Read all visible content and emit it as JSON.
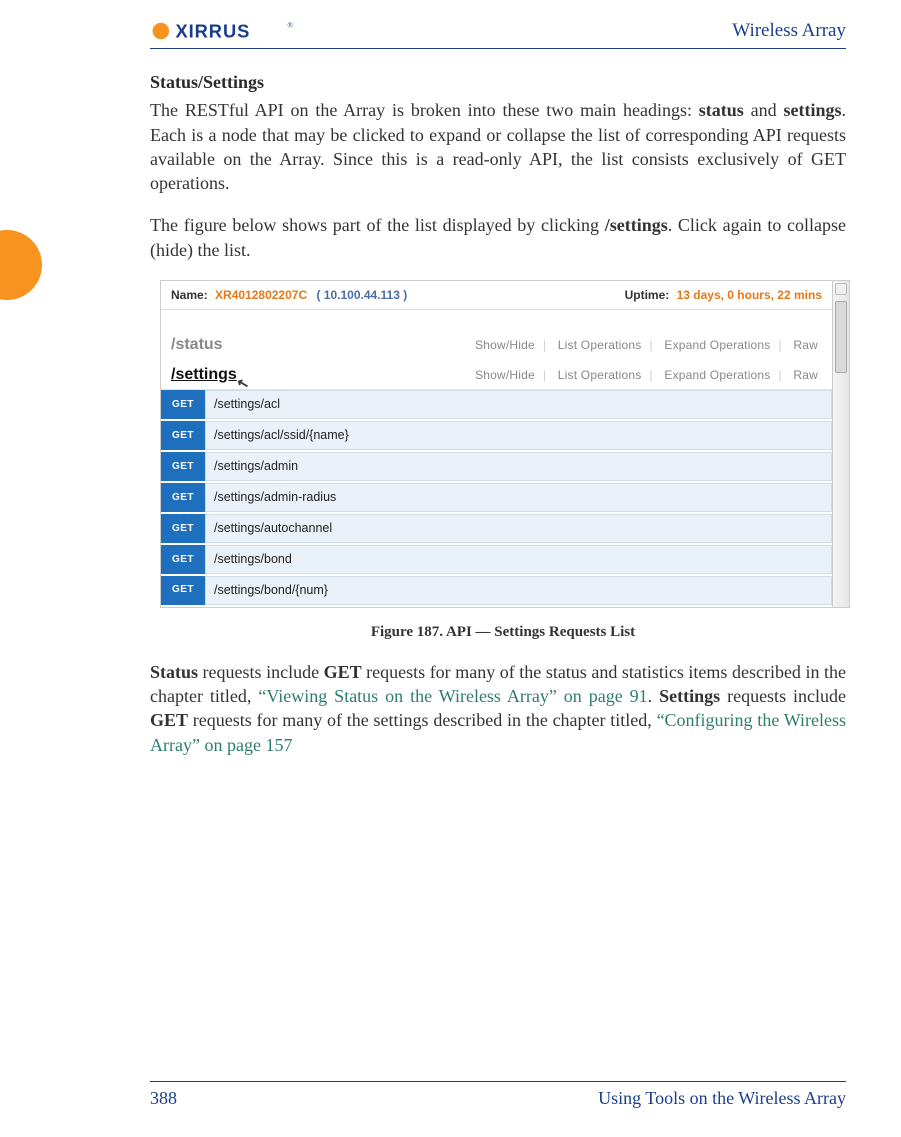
{
  "header": {
    "right_title": "Wireless Array"
  },
  "section": {
    "title": "Status/Settings"
  },
  "para1": {
    "t1": "The RESTful API on the Array is broken into these two main headings: ",
    "b1": "status",
    "t2": " and ",
    "b2": "settings",
    "t3": ". Each is a node that may be clicked to expand or collapse the list of corresponding API requests available on the Array. Since this is a read-only API, the list consists exclusively of GET operations."
  },
  "para2": {
    "t1": "The figure below shows part of the list displayed by clicking ",
    "b1": "/settings",
    "t2": ". Click again to collapse (hide) the list."
  },
  "figure": {
    "name_label": "Name:",
    "name_value": "XR4012802207C",
    "ip": "( 10.100.44.113 )",
    "uptime_label": "Uptime:",
    "uptime_value": "13 days, 0 hours, 22 mins",
    "status_node": "/status",
    "settings_node": "/settings",
    "actions": [
      "Show/Hide",
      "List Operations",
      "Expand Operations",
      "Raw"
    ],
    "badge": "GET",
    "ops": [
      "/settings/acl",
      "/settings/acl/ssid/{name}",
      "/settings/admin",
      "/settings/admin-radius",
      "/settings/autochannel",
      "/settings/bond",
      "/settings/bond/{num}"
    ],
    "caption": "Figure 187. API — Settings Requests List"
  },
  "para3": {
    "b1": "Status",
    "t1": " requests include ",
    "b2": "GET",
    "t2": " requests for many of the status and statistics items described in the chapter titled, ",
    "l1": "“Viewing Status on the Wireless Array” on page 91",
    "t3": ". ",
    "b3": "Settings",
    "t4": " requests include ",
    "b4": "GET",
    "t5": " requests for many of the settings described in the chapter titled, ",
    "l2": "“Configuring the Wireless Array” on page 157"
  },
  "footer": {
    "page": "388",
    "title": "Using Tools on the Wireless Array"
  }
}
